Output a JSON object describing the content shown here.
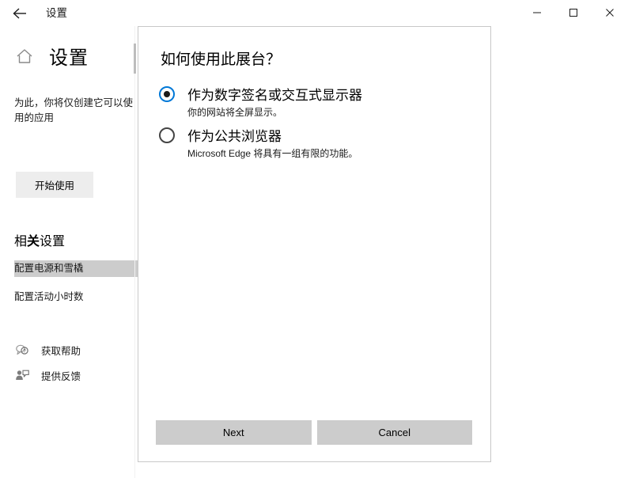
{
  "titlebar": {
    "back_icon": "back-arrow-icon",
    "title": "设置",
    "minimize_icon": "minimize-icon",
    "maximize_icon": "maximize-icon",
    "close_icon": "close-icon"
  },
  "sidebar": {
    "home_icon": "home-icon",
    "page_title": "设置",
    "description": "为此，你将仅创建它可以使用的应用",
    "start_button": "开始使用",
    "related_title_prefix": "相",
    "related_title_bold": "关",
    "related_title_suffix": "设置",
    "related_links": [
      {
        "label": "配置电源和雪橇",
        "selected": true
      },
      {
        "label": "配置活动小时数",
        "selected": false
      }
    ],
    "footer_links": [
      {
        "label": "获取帮助",
        "icon": "help-bubble-icon"
      },
      {
        "label": "提供反馈",
        "icon": "feedback-person-icon"
      }
    ]
  },
  "dialog": {
    "heading": "如何使用此展台？",
    "options": [
      {
        "label": "作为数字签名或交互式显示器",
        "description": "你的网站将全屏显示。",
        "selected": true
      },
      {
        "label": "作为公共浏览器",
        "description": "Microsoft Edge 将具有一组有限的功能。",
        "selected": false
      }
    ],
    "next_button": "Next",
    "cancel_button": "Cancel"
  },
  "colors": {
    "accent": "#0078d7",
    "button_bg": "#cccccc",
    "selection_bg": "#cccccc",
    "start_button_bg": "#ededed",
    "dialog_border": "#c8c8c8"
  }
}
